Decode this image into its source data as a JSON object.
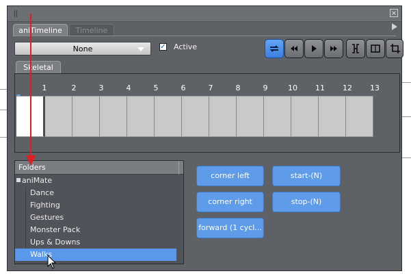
{
  "window": {
    "close_glyph": "×",
    "tabs": [
      {
        "label": "aniTimeline",
        "active": true
      },
      {
        "label": "Timeline",
        "active": false
      }
    ]
  },
  "toolbar": {
    "dropdown_value": "None",
    "active_label": "Active",
    "active_checked": true,
    "buttons": [
      {
        "icon": "loop-icon",
        "on": true
      },
      {
        "icon": "skip-back-icon",
        "on": false
      },
      {
        "icon": "play-icon",
        "on": false
      },
      {
        "icon": "skip-forward-icon",
        "on": false
      },
      {
        "icon": "fit-range-icon",
        "on": false
      },
      {
        "icon": "frame-box-icon",
        "on": false
      },
      {
        "icon": "crop-icon",
        "on": false
      }
    ]
  },
  "timeline": {
    "tab_label": "Skeletal",
    "frames": [
      "1",
      "2",
      "3",
      "4",
      "5",
      "6",
      "7",
      "8",
      "9",
      "10",
      "11",
      "12",
      "13"
    ]
  },
  "folders": {
    "header": "Folders",
    "root": "aniMate",
    "items": [
      "Dance",
      "Fighting",
      "Gestures",
      "Monster Pack",
      "Ups & Downs",
      "Walks"
    ],
    "selected": "Walks"
  },
  "animations": [
    {
      "label": "corner left"
    },
    {
      "label": "start-(N)"
    },
    {
      "label": "corner right"
    },
    {
      "label": "stop-(N)"
    },
    {
      "label": "forward (1 cycl..."
    }
  ],
  "colors": {
    "accent": "#5e9be8",
    "panel": "#5e6165",
    "annotation_arrow": "#e02020"
  }
}
